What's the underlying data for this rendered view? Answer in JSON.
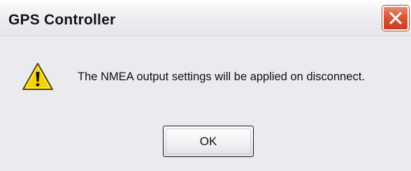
{
  "window": {
    "title": "GPS Controller"
  },
  "icons": {
    "close": "close-icon",
    "warning": "warning-icon"
  },
  "message": {
    "text": "The NMEA output settings will be applied on disconnect."
  },
  "buttons": {
    "ok_label": "OK"
  },
  "colors": {
    "close_button": "#dc5a3c",
    "warning_fill": "#f5d300",
    "dialog_background": "#ebebef"
  }
}
